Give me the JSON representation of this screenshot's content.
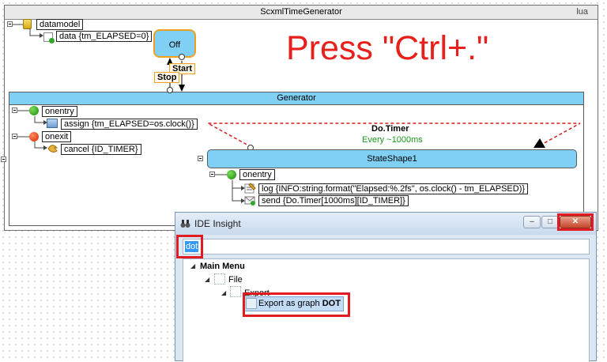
{
  "scxml": {
    "title": "ScxmlTimeGenerator",
    "language": "lua",
    "datamodel_label": "datamodel",
    "data_label": "data {tm_ELAPSED=0}"
  },
  "states": {
    "off": "Off",
    "generator": "Generator",
    "shape1": "StateShape1"
  },
  "transitions": {
    "start": "Start",
    "stop": "Stop",
    "timer_event": "Do.Timer",
    "timer_delay": "Every ~1000ms"
  },
  "hint": "Press \"Ctrl+.\"",
  "generator": {
    "onentry": "onentry",
    "assign": "assign {tm_ELAPSED=os.clock()}",
    "onexit": "onexit",
    "cancel": "cancel {ID_TIMER}"
  },
  "shape1": {
    "onentry": "onentry",
    "log": "log {INFO:string.format(\"Elapsed:%.2fs\", os.clock() - tm_ELAPSED)}",
    "send": "send {Do.Timer[1000ms][ID_TIMER]}"
  },
  "window": {
    "title": "IDE Insight",
    "minimize": "–",
    "maximize": "□",
    "close": "✕",
    "search_value": "dot",
    "tree": {
      "root": "Main Menu",
      "file": "File",
      "export": "Export",
      "result_prefix": "Export as graph ",
      "result_match": "DOT"
    }
  },
  "colors": {
    "state_fill": "#7fd0f4",
    "highlight_red": "#e01b22",
    "active_border": "#f0a020",
    "timer_green": "#1a9a1a"
  }
}
